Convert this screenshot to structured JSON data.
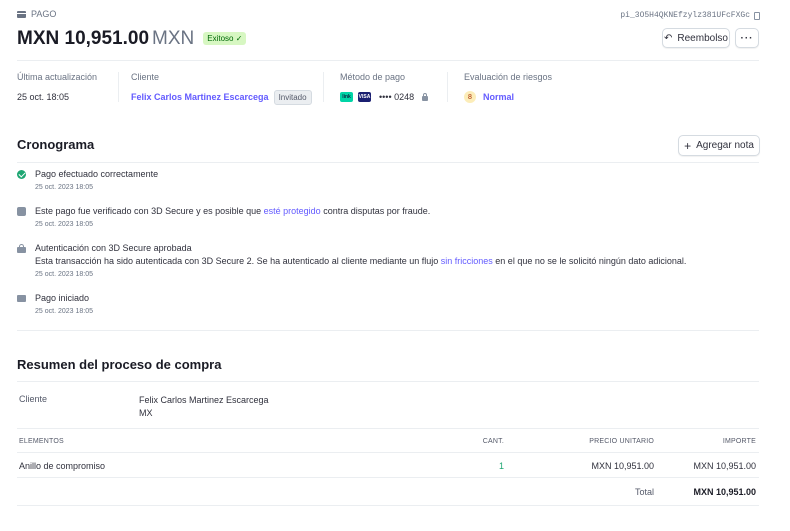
{
  "header": {
    "label": "PAGO",
    "payment_id": "pi_3O5H4QKNEfzylz381UFcFXGc",
    "amount": "MXN 10,951.00",
    "currency": "MXN",
    "status": "Exitoso ✓",
    "refund_label": "Reembolso",
    "more_label": "···"
  },
  "meta": {
    "updated_label": "Última actualización",
    "updated_value": "25 oct. 18:05",
    "customer_label": "Cliente",
    "customer_value": "Felix Carlos Martinez Escarcega",
    "customer_tag": "Invitado",
    "method_label": "Método de pago",
    "method_logo1": "link",
    "method_logo2": "VISA",
    "method_value": "•••• 0248",
    "risk_label": "Evaluación de riesgos",
    "risk_score": "8",
    "risk_value": "Normal"
  },
  "timeline": {
    "title": "Cronograma",
    "add_note": "Agregar nota",
    "events": [
      {
        "title": "Pago efectuado correctamente",
        "date": "25 oct. 2023 18:05"
      },
      {
        "title_a": "Este pago fue verificado con 3D Secure y es posible que ",
        "title_link": "esté protegido",
        "title_b": " contra disputas por fraude.",
        "date": "25 oct. 2023 18:05"
      },
      {
        "title": "Autenticación con 3D Secure aprobada",
        "detail_a": "Esta transacción ha sido autenticada con 3D Secure 2. Se ha autenticado al cliente mediante un flujo ",
        "detail_link": "sin fricciones",
        "detail_b": " en el que no se le solicitó ningún dato adicional.",
        "date": "25 oct. 2023 18:05"
      },
      {
        "title": "Pago iniciado",
        "date": "25 oct. 2023 18:05"
      }
    ]
  },
  "checkout": {
    "title": "Resumen del proceso de compra",
    "customer_label": "Cliente",
    "customer_name": "Felix Carlos Martinez Escarcega",
    "customer_country": "MX",
    "columns": {
      "items": "ELEMENTOS",
      "qty": "CANT.",
      "unit_price": "PRECIO UNITARIO",
      "amount": "IMPORTE"
    },
    "items": [
      {
        "name": "Anillo de compromiso",
        "qty": "1",
        "unit_price": "MXN 10,951.00",
        "amount": "MXN 10,951.00"
      }
    ],
    "total_label": "Total",
    "total_value": "MXN 10,951.00"
  }
}
